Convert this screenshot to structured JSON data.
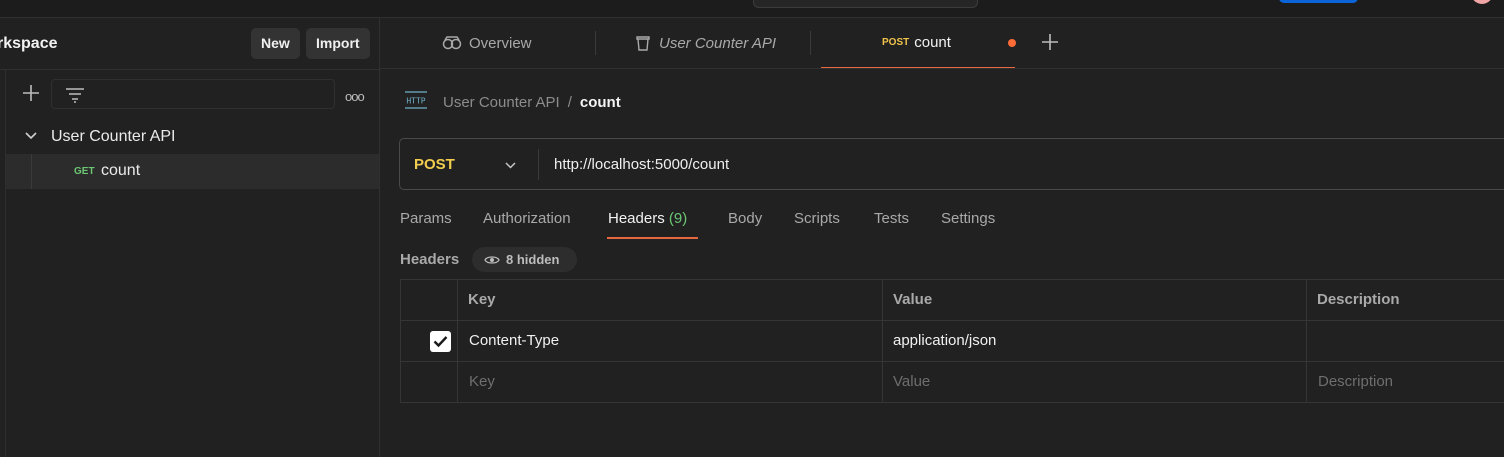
{
  "sidebar": {
    "workspace_title": "rkspace",
    "new_label": "New",
    "import_label": "Import",
    "more_glyph": "ooo",
    "tree": {
      "collection_label": "User Counter API",
      "request": {
        "method": "GET",
        "label": "count"
      }
    }
  },
  "tabs": [
    {
      "label": "Overview"
    },
    {
      "label": "User Counter API"
    },
    {
      "method": "POST",
      "label": "count"
    }
  ],
  "breadcrumb": {
    "icon_text": "HTTP",
    "parent": "User Counter API",
    "separator": "/",
    "current": "count"
  },
  "request": {
    "method": "POST",
    "url": "http://localhost:5000/count"
  },
  "request_tabs": {
    "params": "Params",
    "authorization": "Authorization",
    "headers": "Headers",
    "headers_count": "(9)",
    "body": "Body",
    "scripts": "Scripts",
    "tests": "Tests",
    "settings": "Settings"
  },
  "headers_section": {
    "label": "Headers",
    "hidden_label": "8 hidden"
  },
  "table": {
    "columns": [
      "Key",
      "Value",
      "Description"
    ],
    "rows": [
      {
        "checked": true,
        "key": "Content-Type",
        "value": "application/json",
        "description": ""
      }
    ],
    "placeholders": {
      "key": "Key",
      "value": "Value",
      "description": "Description"
    }
  },
  "colors": {
    "accent": "#e5673d",
    "post": "#f3cd4f",
    "get": "#6bc774",
    "unsaved_dot": "#ff6b36"
  }
}
